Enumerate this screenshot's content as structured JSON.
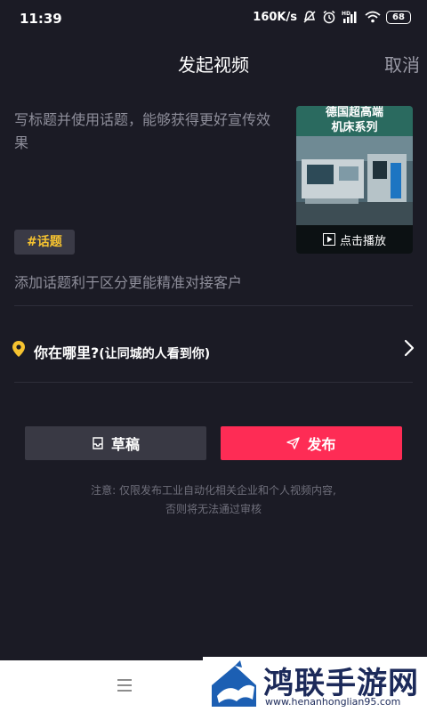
{
  "status_bar": {
    "time": "11:39",
    "network_speed": "160K/s",
    "battery": "68",
    "icons": [
      "mute-icon",
      "alarm-icon",
      "hd-signal-icon",
      "wifi-icon",
      "battery-icon"
    ]
  },
  "nav": {
    "title": "发起视频",
    "cancel_label": "取消"
  },
  "post": {
    "caption_placeholder": "写标题并使用话题，能够获得更好宣传效果",
    "topic_tag": "#话题",
    "topic_hint": "添加话题利于区分更能精准对接客户"
  },
  "thumbnail": {
    "title_line1": "德国超高端",
    "title_line2": "机床系列",
    "play_label": "点击播放"
  },
  "location": {
    "label": "你在哪里?",
    "sub_label": "(让同城的人看到你)"
  },
  "actions": {
    "draft_label": "草稿",
    "publish_label": "发布"
  },
  "notice": {
    "line1": "注意: 仅限发布工业自动化相关企业和个人视频内容,",
    "line2": "否则将无法通过审核"
  },
  "watermark": {
    "title": "鸿联手游网",
    "url": "www.henanhonglian95.com"
  },
  "colors": {
    "background": "#1b1b25",
    "accent": "#fe2c55",
    "topic": "#f6c330",
    "secondary": "#393944"
  }
}
